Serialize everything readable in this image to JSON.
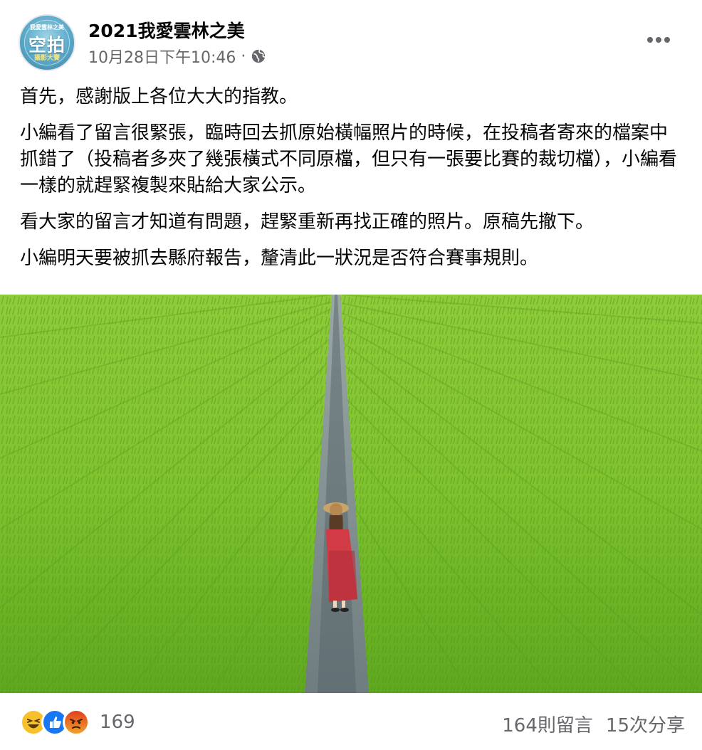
{
  "post": {
    "page_name": "2021我愛雲林之美",
    "timestamp": "10月28日下午10:46",
    "separator": "·",
    "privacy_icon": "globe-icon",
    "avatar": {
      "top_text": "我愛雲林之美",
      "main_text": "空拍",
      "bottom_text": "攝影大賽"
    },
    "paragraphs": [
      "首先，感謝版上各位大大的指教。",
      "小編看了留言很緊張，臨時回去抓原始橫幅照片的時候，在投稿者寄來的檔案中抓錯了（投稿者多夾了幾張橫式不同原檔，但只有一張要比賽的裁切檔），小編看一樣的就趕緊複製來貼給大家公示。",
      "看大家的留言才知道有問題，趕緊重新再找正確的照片。原稿先撤下。",
      "小編明天要被抓去縣府報告，釐清此一狀況是否符合賽事規則。"
    ],
    "photo_icon": "rice-field-aerial-photo"
  },
  "footer": {
    "reactions": [
      "haha",
      "like",
      "angry"
    ],
    "reaction_count": "169",
    "comments": "164則留言",
    "shares": "15次分享"
  },
  "colors": {
    "text_primary": "#050505",
    "text_secondary": "#65676b",
    "like_blue": "#1877f2",
    "haha_yellow": "#f7c12b",
    "angry_orange": "#e9710f",
    "field_green": "#7cc22a"
  }
}
